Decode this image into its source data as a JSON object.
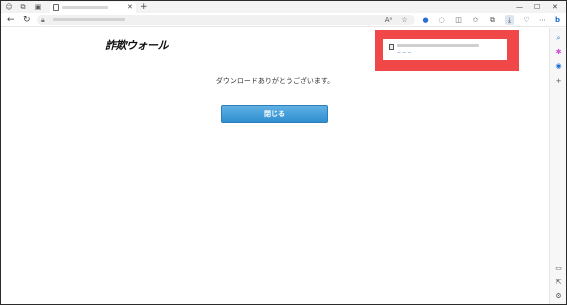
{
  "browser": {
    "tab": {
      "close_glyph": "✕"
    },
    "new_tab_glyph": "+",
    "window_controls": {
      "minimize": "—",
      "maximize": "☐",
      "close": "✕"
    },
    "nav": {
      "back": "←",
      "refresh": "↻"
    },
    "toolbar_icons": [
      "read-aloud-icon",
      "favorite-star-icon",
      "extension-icon",
      "extension-icon",
      "split-screen-icon",
      "favorites-icon",
      "collections-icon",
      "downloads-icon",
      "browser-essentials-icon",
      "more-menu-icon"
    ],
    "toolbar_glyphs": {
      "read_aloud": "Aᵃ",
      "favorite": "☆",
      "ext1": "●",
      "ext2": "◌",
      "split": "◫",
      "favorites": "✩",
      "collections": "⧉",
      "downloads": "⤓",
      "essentials": "♡",
      "more": "⋯"
    }
  },
  "sidebar": {
    "bing_glyph": "b",
    "search_glyph": "⌕",
    "copilot_glyph": "✱",
    "outlook_glyph": "◉",
    "add_glyph": "+",
    "bottom_glyphs": {
      "layout": "▭",
      "external": "⇱",
      "settings": "⚙"
    }
  },
  "page": {
    "logo_text": "詐欺ウォール",
    "message": "ダウンロードありがとうございます。",
    "close_button_label": "閉じる"
  },
  "downloads_panel": {
    "highlight_color": "#f04848"
  }
}
